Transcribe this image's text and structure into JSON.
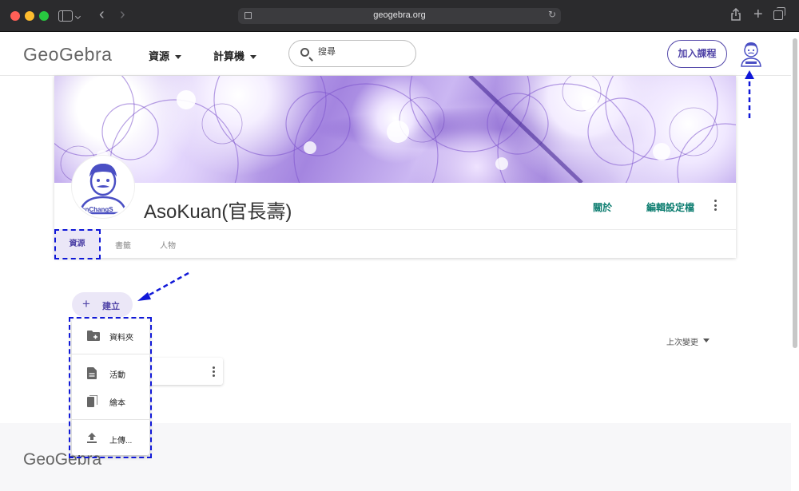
{
  "browser": {
    "url": "geogebra.org"
  },
  "topnav": {
    "logo": "GeoGebra",
    "resources_label": "資源",
    "calculator_label": "計算機",
    "search_placeholder": "搜尋",
    "join_class_label": "加入課程"
  },
  "profile": {
    "name": "AsoKuan(官長壽)",
    "avatar_caption": "anChangS",
    "about_label": "關於",
    "edit_label": "編輯設定檔",
    "tabs": [
      {
        "label": "資源",
        "active": true
      },
      {
        "label": "書籤",
        "active": false
      },
      {
        "label": "人物",
        "active": false
      }
    ]
  },
  "create": {
    "button_label": "建立",
    "menu": [
      {
        "label": "資料夾",
        "icon": "folder-add-icon"
      },
      {
        "label": "活動",
        "icon": "document-icon"
      },
      {
        "label": "繪本",
        "icon": "book-icon"
      },
      {
        "label": "上傳...",
        "icon": "upload-icon"
      }
    ]
  },
  "sort": {
    "label": "上次變更"
  },
  "footer": {
    "logo": "GeoGebra"
  },
  "colors": {
    "accent": "#5145a8",
    "link": "#0b7c6f",
    "annotation": "#1018d8"
  }
}
